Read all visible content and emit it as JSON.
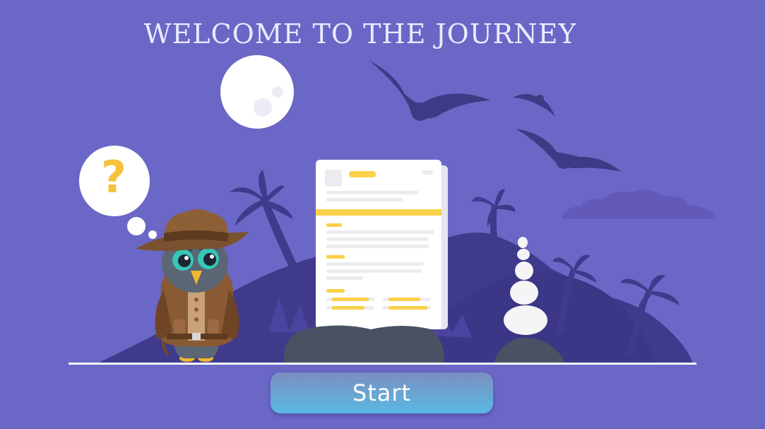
{
  "title": "WELCOME TO THE JOURNEY",
  "thought_symbol": "?",
  "start_label": "Start",
  "colors": {
    "background": "#6b67c6",
    "silhouette": "#3f3a8c",
    "bat": "#3e3a86",
    "moon": "#ffffff",
    "accent_yellow": "#f9d24a",
    "button_top": "#7a8fc0",
    "button_bottom": "#5ab8e3"
  },
  "icons": [
    "moon-icon",
    "bat-icon",
    "palm-tree-icon",
    "cloud-icon",
    "thought-bubble-icon",
    "owl-explorer-icon",
    "document-icon",
    "stone-stack-icon",
    "rock-icon"
  ]
}
